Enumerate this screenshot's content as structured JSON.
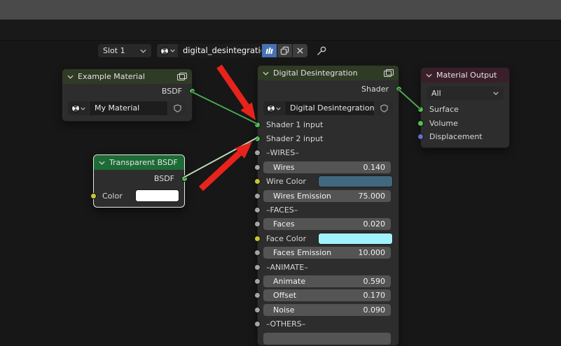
{
  "colors": {
    "wire_green": "#4da652",
    "wire_pale": "#bcdab4",
    "arrow_red": "#e8231c",
    "header_olive": "#2f3b24",
    "header_green": "#1d6b35",
    "header_maroon": "#3a1f2a",
    "wire_color_swatch": "#41687f",
    "face_color_swatch": "#a2f2fb",
    "transparent_color_swatch": "#ffffff"
  },
  "topbar": {
    "slot": "Slot 1",
    "material_name": "digital_desintegration"
  },
  "nodes": {
    "example_material": {
      "title": "Example Material",
      "output_label": "BSDF",
      "selector_value": "My Material"
    },
    "transparent_bsdf": {
      "title": "Transparent BSDF",
      "output_label": "BSDF",
      "color_label": "Color"
    },
    "digital": {
      "title": "Digital Desintegration",
      "output_label": "Shader",
      "selector_value": "Digital Desintegration",
      "rows": [
        {
          "type": "input",
          "label": "Shader 1 input",
          "socket": "green"
        },
        {
          "type": "input",
          "label": "Shader 2 input",
          "socket": "green"
        },
        {
          "type": "section",
          "label": "–WIRES–",
          "socket": "gray"
        },
        {
          "type": "slider",
          "label": "Wires",
          "value": "0.140",
          "socket": "gray"
        },
        {
          "type": "color",
          "label": "Wire Color",
          "swatch": "#41687f",
          "socket": "yellow"
        },
        {
          "type": "slider",
          "label": "Wires Emission",
          "value": "75.000",
          "socket": "gray"
        },
        {
          "type": "section",
          "label": "–FACES–",
          "socket": "gray"
        },
        {
          "type": "slider",
          "label": "Faces",
          "value": "0.020",
          "socket": "gray"
        },
        {
          "type": "color",
          "label": "Face Color",
          "swatch": "#a2f2fb",
          "socket": "yellow"
        },
        {
          "type": "slider",
          "label": "Faces Emission",
          "value": "10.000",
          "socket": "gray"
        },
        {
          "type": "section",
          "label": "–ANIMATE–",
          "socket": "gray"
        },
        {
          "type": "slider",
          "label": "Animate",
          "value": "0.590",
          "socket": "gray"
        },
        {
          "type": "slider",
          "label": "Offset",
          "value": "0.170",
          "socket": "gray"
        },
        {
          "type": "slider",
          "label": "Noise",
          "value": "0.090",
          "socket": "gray"
        },
        {
          "type": "section",
          "label": "–OTHERS–",
          "socket": "gray"
        },
        {
          "type": "slider_partial",
          "label": "",
          "value": "",
          "socket": null
        }
      ]
    },
    "material_output": {
      "title": "Material Output",
      "target_dropdown": "All",
      "inputs": [
        {
          "label": "Surface",
          "socket": "green"
        },
        {
          "label": "Volume",
          "socket": "green"
        },
        {
          "label": "Displacement",
          "socket": "purple"
        }
      ]
    }
  }
}
